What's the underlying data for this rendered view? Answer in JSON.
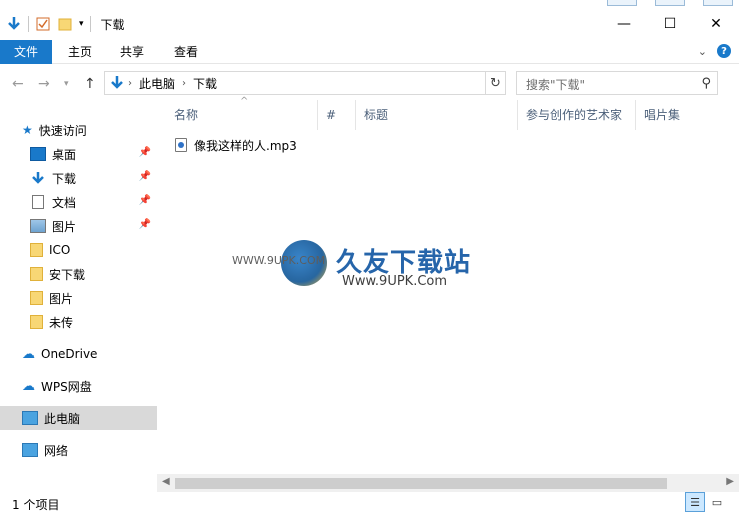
{
  "window": {
    "title": "下载",
    "controls": {
      "minimize": "—",
      "maximize": "☐",
      "close": "✕"
    }
  },
  "ribbon": {
    "tabs": [
      "文件",
      "主页",
      "共享",
      "查看"
    ],
    "help_label": "?"
  },
  "address": {
    "crumbs": [
      "此电脑",
      "下载"
    ],
    "search_placeholder": "搜索\"下载\""
  },
  "sidebar": {
    "quick_access": "快速访问",
    "items": [
      {
        "label": "桌面",
        "icon": "desktop-icon",
        "pinned": true
      },
      {
        "label": "下载",
        "icon": "download-icon",
        "pinned": true
      },
      {
        "label": "文档",
        "icon": "document-icon",
        "pinned": true
      },
      {
        "label": "图片",
        "icon": "picture-icon",
        "pinned": true
      },
      {
        "label": "ICO",
        "icon": "folder-icon",
        "pinned": false
      },
      {
        "label": "安下载",
        "icon": "folder-icon",
        "pinned": false
      },
      {
        "label": "图片",
        "icon": "folder-icon",
        "pinned": false
      },
      {
        "label": "未传",
        "icon": "folder-icon",
        "pinned": false
      }
    ],
    "onedrive": "OneDrive",
    "wps": "WPS网盘",
    "this_pc": "此电脑",
    "network": "网络"
  },
  "columns": [
    "名称",
    "#",
    "标题",
    "参与创作的艺术家",
    "唱片集"
  ],
  "files": [
    {
      "name": "像我这样的人.mp3",
      "icon": "audio-file-icon"
    }
  ],
  "watermark": {
    "title": "久友下载站",
    "url_left": "WWW.9UPK.COM",
    "url_right": "Www.9UPK.Com"
  },
  "status": {
    "count": "1 个项目"
  },
  "colors": {
    "accent": "#1979ca",
    "selected_bg": "#cce8ff",
    "header_text": "#4c607a"
  }
}
